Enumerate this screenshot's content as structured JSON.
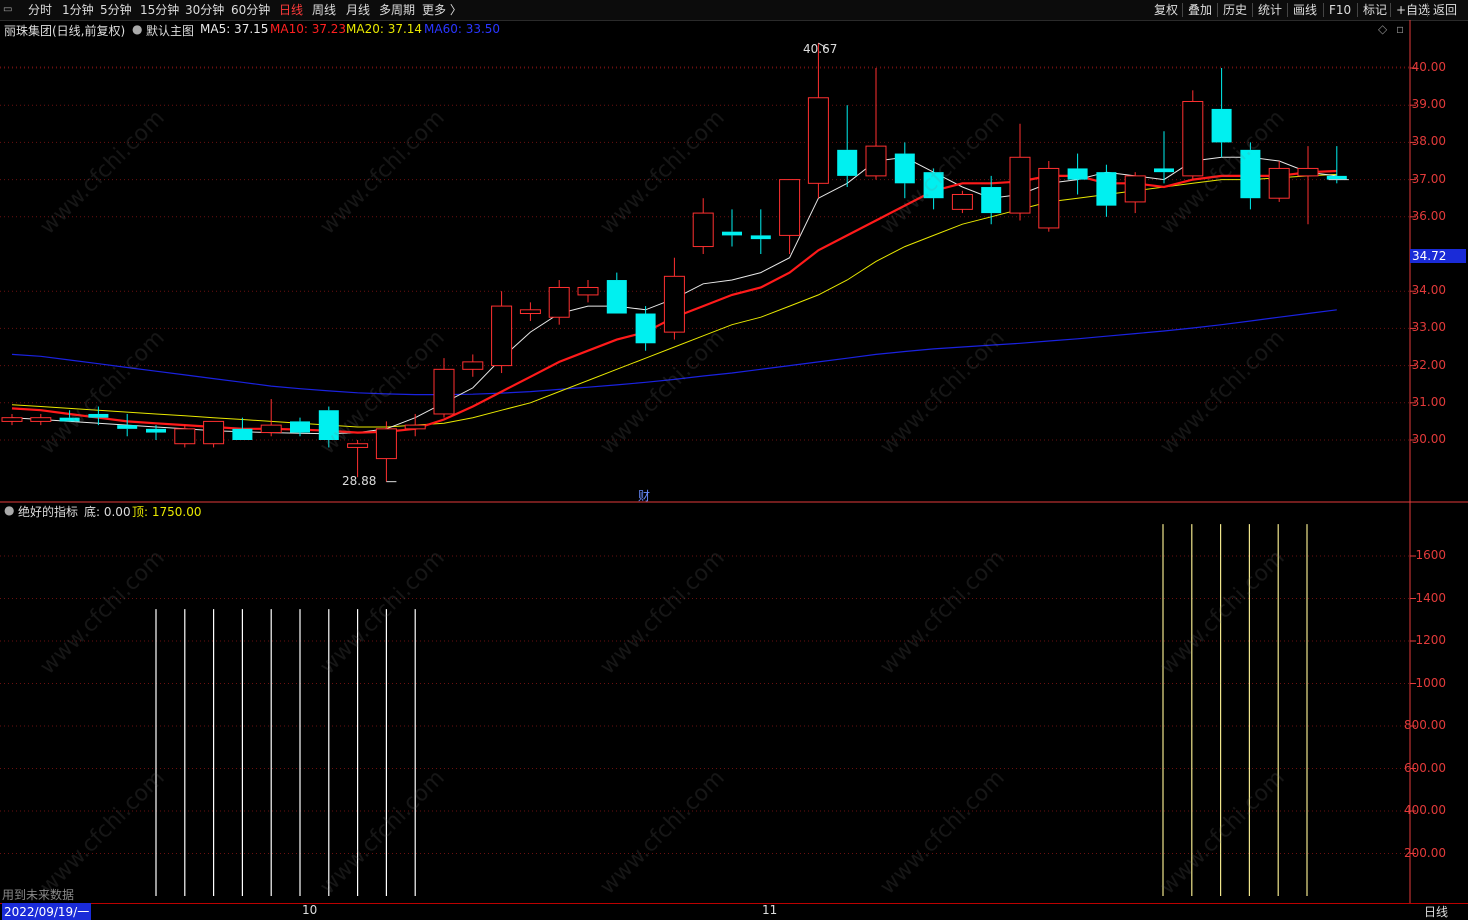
{
  "toolbar": {
    "periods": [
      {
        "label": "分时",
        "active": false
      },
      {
        "label": "1分钟",
        "active": false
      },
      {
        "label": "5分钟",
        "active": false
      },
      {
        "label": "15分钟",
        "active": false
      },
      {
        "label": "30分钟",
        "active": false
      },
      {
        "label": "60分钟",
        "active": false
      },
      {
        "label": "日线",
        "active": true
      },
      {
        "label": "周线",
        "active": false
      },
      {
        "label": "月线",
        "active": false
      },
      {
        "label": "多周期",
        "active": false
      },
      {
        "label": "更多 〉",
        "active": false
      }
    ],
    "right_buttons": [
      "复权",
      "叠加",
      "历史",
      "统计",
      "画线",
      "F10",
      "标记",
      "+自选",
      "返回"
    ]
  },
  "main_header": {
    "stock": "丽珠集团(日线,前复权)",
    "template": "默认主图",
    "ma5": "MA5: 37.15",
    "ma10": "MA10: 37.23",
    "ma20": "MA20: 37.14",
    "ma60": "MA60: 33.50"
  },
  "colors": {
    "up": "#ff3030",
    "down": "#00f0f0",
    "ma5": "#e8e8e8",
    "ma10": "#ff1a1a",
    "ma20": "#e8e800",
    "ma60": "#1a22e0",
    "axis": "#e23a3a",
    "grid": "#6a1010"
  },
  "price_axis": [
    "40.00",
    "39.00",
    "38.00",
    "37.00",
    "36.00",
    "34.00",
    "33.00",
    "32.00",
    "31.00",
    "30.00"
  ],
  "current_price_badge": "34.72",
  "annotations": {
    "high": "40.67",
    "low": "28.88",
    "cai": "财"
  },
  "indicator": {
    "name": "绝好的指标",
    "di": "底: 0.00",
    "ding": "顶: 1750.00",
    "axis": [
      "1600",
      "1400",
      "1200",
      "1000",
      "800.00",
      "600.00",
      "400.00",
      "200.00"
    ],
    "note": "用到未来数据",
    "di_values": [
      1350,
      1350,
      1350,
      1350,
      1350,
      1350,
      1350,
      1350,
      1350,
      1350
    ],
    "ding_values": [
      1750,
      1750,
      1750,
      1750,
      1750,
      1750
    ]
  },
  "time_axis": {
    "start": "2022/09/19/一",
    "m10": "10",
    "m11": "11",
    "period": "日线"
  },
  "watermark": "www.cfchi.com",
  "chart_data": {
    "type": "candlestick",
    "ohlc": [
      [
        30.5,
        30.7,
        30.4,
        30.6
      ],
      [
        30.5,
        30.7,
        30.4,
        30.6
      ],
      [
        30.6,
        30.8,
        30.5,
        30.5
      ],
      [
        30.7,
        30.9,
        30.4,
        30.6
      ],
      [
        30.4,
        30.7,
        30.1,
        30.3
      ],
      [
        30.3,
        30.4,
        30.0,
        30.2
      ],
      [
        29.9,
        30.4,
        29.8,
        30.3
      ],
      [
        29.9,
        30.5,
        29.8,
        30.5
      ],
      [
        30.3,
        30.6,
        30.0,
        30.0
      ],
      [
        30.2,
        31.1,
        30.1,
        30.4
      ],
      [
        30.5,
        30.6,
        30.1,
        30.2
      ],
      [
        30.8,
        30.9,
        29.8,
        30.0
      ],
      [
        29.8,
        30.0,
        29.0,
        29.9
      ],
      [
        29.5,
        30.5,
        28.88,
        30.3
      ],
      [
        30.3,
        30.7,
        30.1,
        30.4
      ],
      [
        30.7,
        32.2,
        30.6,
        31.9
      ],
      [
        31.9,
        32.3,
        31.7,
        32.1
      ],
      [
        32.0,
        34.0,
        31.8,
        33.6
      ],
      [
        33.4,
        33.7,
        33.2,
        33.5
      ],
      [
        33.3,
        34.3,
        33.1,
        34.1
      ],
      [
        33.9,
        34.3,
        33.7,
        34.1
      ],
      [
        34.3,
        34.5,
        33.4,
        33.4
      ],
      [
        33.4,
        33.6,
        32.4,
        32.6
      ],
      [
        32.9,
        34.9,
        32.7,
        34.4
      ],
      [
        35.2,
        36.5,
        35.0,
        36.1
      ],
      [
        35.6,
        36.2,
        35.2,
        35.5
      ],
      [
        35.5,
        36.2,
        35.0,
        35.4
      ],
      [
        35.5,
        37.0,
        35.0,
        37.0
      ],
      [
        36.9,
        40.67,
        36.5,
        39.2
      ],
      [
        37.8,
        39.0,
        36.8,
        37.1
      ],
      [
        37.1,
        40.0,
        37.0,
        37.9
      ],
      [
        37.7,
        38.0,
        36.5,
        36.9
      ],
      [
        37.2,
        37.3,
        36.2,
        36.5
      ],
      [
        36.2,
        36.7,
        36.1,
        36.6
      ],
      [
        36.8,
        37.1,
        35.8,
        36.1
      ],
      [
        36.1,
        38.5,
        35.9,
        37.6
      ],
      [
        35.7,
        37.5,
        35.6,
        37.3
      ],
      [
        37.3,
        37.7,
        36.6,
        37.0
      ],
      [
        37.2,
        37.4,
        36.0,
        36.3
      ],
      [
        36.4,
        37.2,
        36.1,
        37.1
      ],
      [
        37.3,
        38.3,
        36.9,
        37.2
      ],
      [
        37.1,
        39.4,
        37.0,
        39.1
      ],
      [
        38.9,
        40.0,
        37.6,
        38.0
      ],
      [
        37.8,
        38.0,
        36.2,
        36.5
      ],
      [
        36.5,
        37.5,
        36.4,
        37.3
      ],
      [
        37.1,
        37.9,
        35.8,
        37.3
      ],
      [
        37.1,
        37.9,
        36.9,
        37.0
      ]
    ],
    "ma5": [
      30.6,
      30.55,
      30.5,
      30.45,
      30.4,
      30.35,
      30.3,
      30.25,
      30.22,
      30.2,
      30.18,
      30.17,
      30.2,
      30.3,
      30.6,
      31.0,
      31.4,
      32.2,
      32.9,
      33.4,
      33.6,
      33.6,
      33.5,
      33.8,
      34.2,
      34.3,
      34.5,
      34.9,
      36.5,
      36.9,
      37.5,
      37.6,
      37.2,
      36.8,
      36.5,
      36.6,
      36.9,
      37.0,
      37.2,
      37.1,
      37.0,
      37.5,
      37.6,
      37.6,
      37.5,
      37.2,
      37.1
    ],
    "ma10": [
      30.85,
      30.8,
      30.7,
      30.6,
      30.5,
      30.45,
      30.4,
      30.35,
      30.3,
      30.3,
      30.28,
      30.25,
      30.2,
      30.22,
      30.3,
      30.55,
      30.9,
      31.3,
      31.7,
      32.1,
      32.4,
      32.7,
      32.9,
      33.3,
      33.6,
      33.9,
      34.1,
      34.5,
      35.1,
      35.5,
      35.9,
      36.3,
      36.7,
      36.9,
      36.9,
      36.95,
      37.1,
      37.1,
      36.9,
      36.9,
      36.8,
      37.0,
      37.1,
      37.1,
      37.1,
      37.2,
      37.23
    ],
    "ma20": [
      30.95,
      30.9,
      30.85,
      30.8,
      30.75,
      30.7,
      30.65,
      30.6,
      30.55,
      30.5,
      30.45,
      30.4,
      30.35,
      30.35,
      30.4,
      30.45,
      30.6,
      30.8,
      31.0,
      31.3,
      31.6,
      31.9,
      32.2,
      32.5,
      32.8,
      33.1,
      33.3,
      33.6,
      33.9,
      34.3,
      34.8,
      35.2,
      35.5,
      35.8,
      36.0,
      36.2,
      36.4,
      36.5,
      36.6,
      36.7,
      36.8,
      36.9,
      37.0,
      37.0,
      37.05,
      37.1,
      37.14
    ],
    "ma60": [
      32.3,
      32.25,
      32.15,
      32.05,
      31.95,
      31.85,
      31.75,
      31.65,
      31.55,
      31.45,
      31.38,
      31.32,
      31.27,
      31.24,
      31.22,
      31.22,
      31.23,
      31.26,
      31.3,
      31.36,
      31.42,
      31.48,
      31.55,
      31.63,
      31.72,
      31.8,
      31.9,
      32.0,
      32.1,
      32.2,
      32.3,
      32.38,
      32.45,
      32.5,
      32.55,
      32.6,
      32.66,
      32.72,
      32.79,
      32.86,
      32.93,
      33.01,
      33.1,
      33.2,
      33.3,
      33.4,
      33.5
    ],
    "y_range": [
      28.0,
      41.0
    ]
  }
}
